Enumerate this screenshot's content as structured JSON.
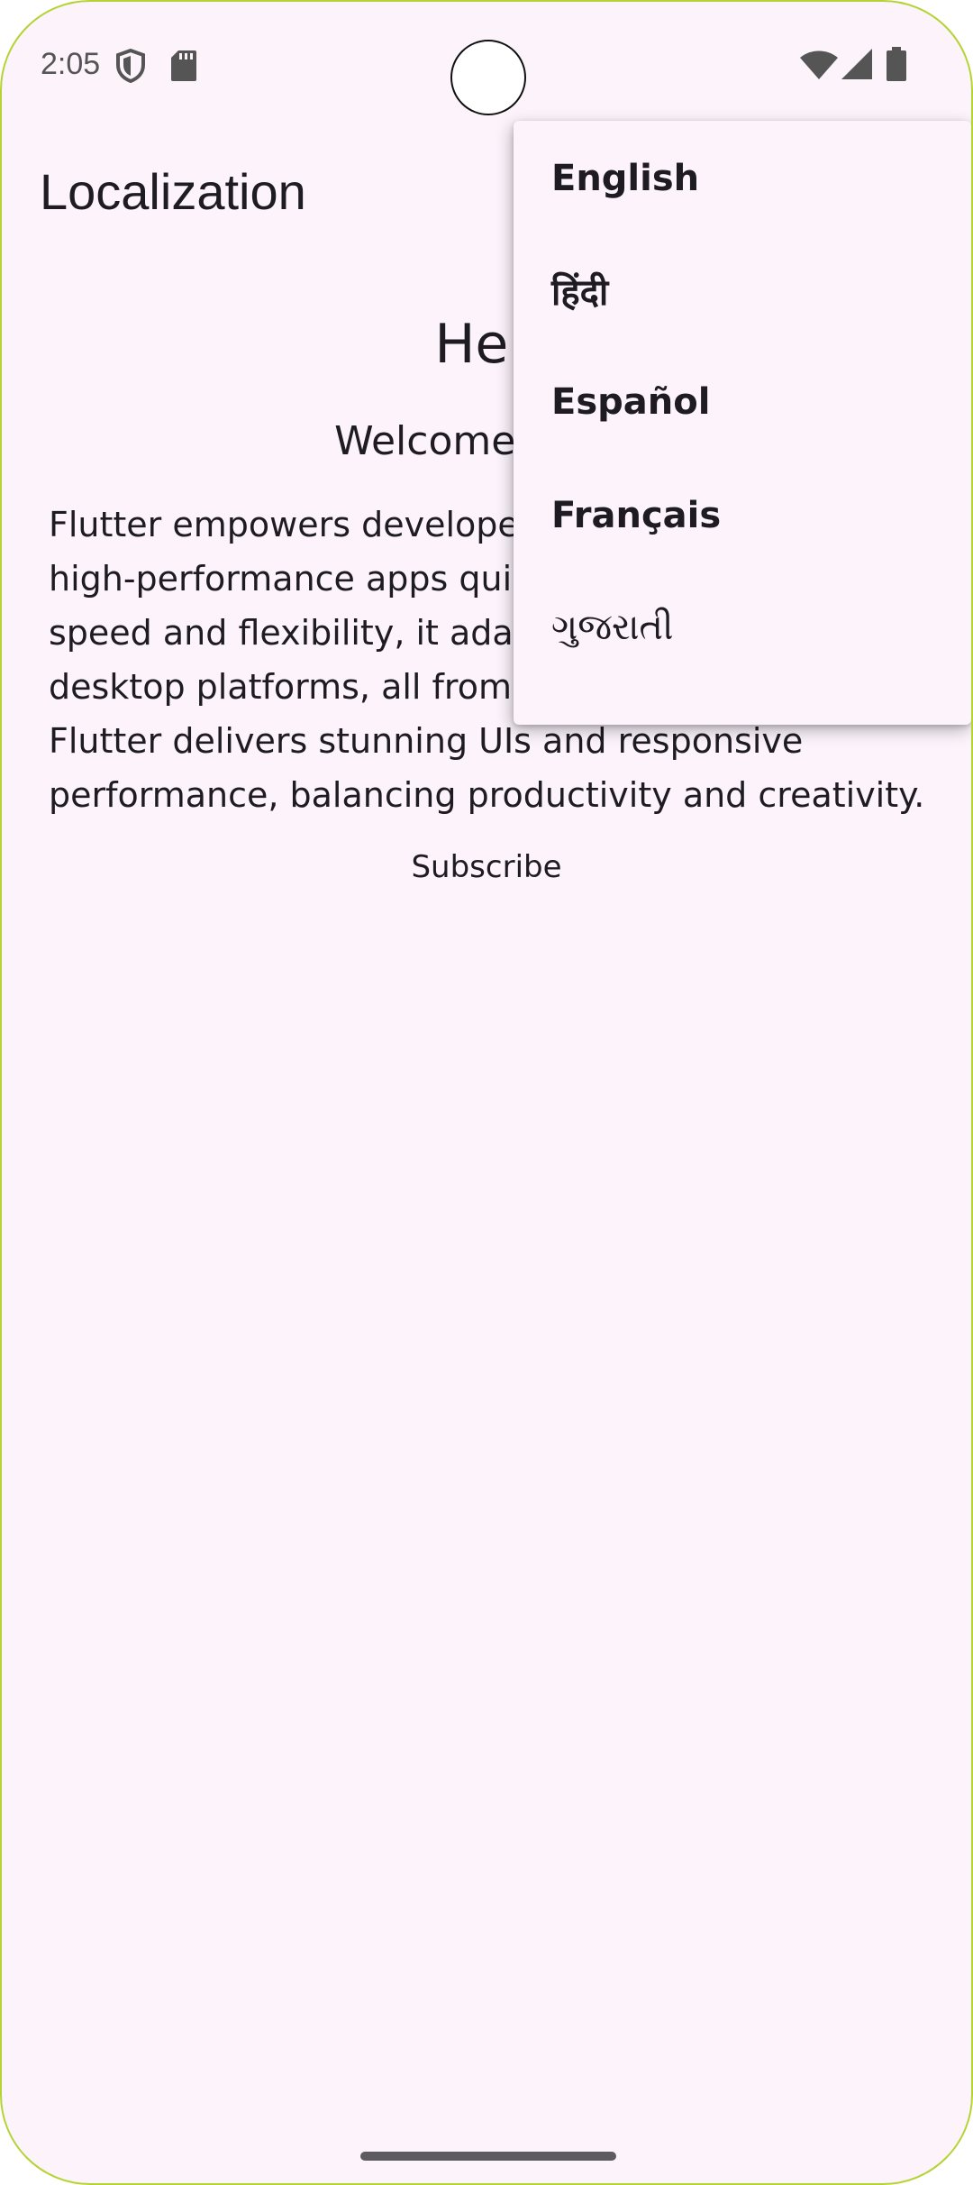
{
  "status_bar": {
    "time": "2:05"
  },
  "app_bar": {
    "title": "Localization"
  },
  "content": {
    "hello": "Hell",
    "welcome": "Welcome! Let’s",
    "body_lines": [
      "Flutter empowers develope",
      "high-performance apps qui",
      "speed and flexibility, it adap",
      "desktop platforms, all from",
      "Flutter delivers stunning UIs and responsive",
      "performance, balancing productivity and creativity."
    ],
    "subscribe_label": "Subscribe"
  },
  "language_menu": {
    "items": [
      {
        "label": "English"
      },
      {
        "label": "हिंदी"
      },
      {
        "label": "Español"
      },
      {
        "label": "Français"
      },
      {
        "label": "ગુજરાતી"
      }
    ]
  },
  "colors": {
    "background": "#fcf3fb",
    "text": "#1e1b22",
    "device_border": "#b5d334"
  },
  "icons": [
    "shield-icon",
    "sd-card-icon",
    "wifi-icon",
    "signal-icon",
    "battery-icon"
  ]
}
